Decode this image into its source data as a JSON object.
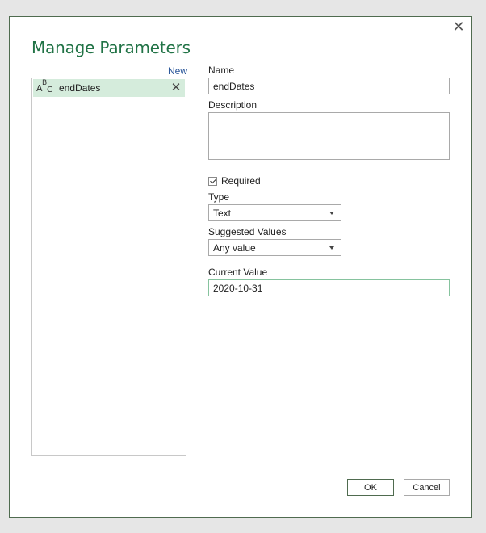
{
  "dialog": {
    "title": "Manage Parameters",
    "close_glyph": "✕"
  },
  "list": {
    "new_label": "New",
    "items": [
      {
        "label": "endDates",
        "icon": "abc-text-type-icon"
      }
    ]
  },
  "form": {
    "name_label": "Name",
    "name_value": "endDates",
    "description_label": "Description",
    "description_value": "",
    "required_label": "Required",
    "required_checked": true,
    "type_label": "Type",
    "type_value": "Text",
    "suggested_label": "Suggested Values",
    "suggested_value": "Any value",
    "current_label": "Current Value",
    "current_value": "2020-10-31"
  },
  "buttons": {
    "ok": "OK",
    "cancel": "Cancel"
  },
  "colors": {
    "accent": "#217346",
    "selected_row": "#d5ecdc",
    "link": "#2b579a"
  }
}
